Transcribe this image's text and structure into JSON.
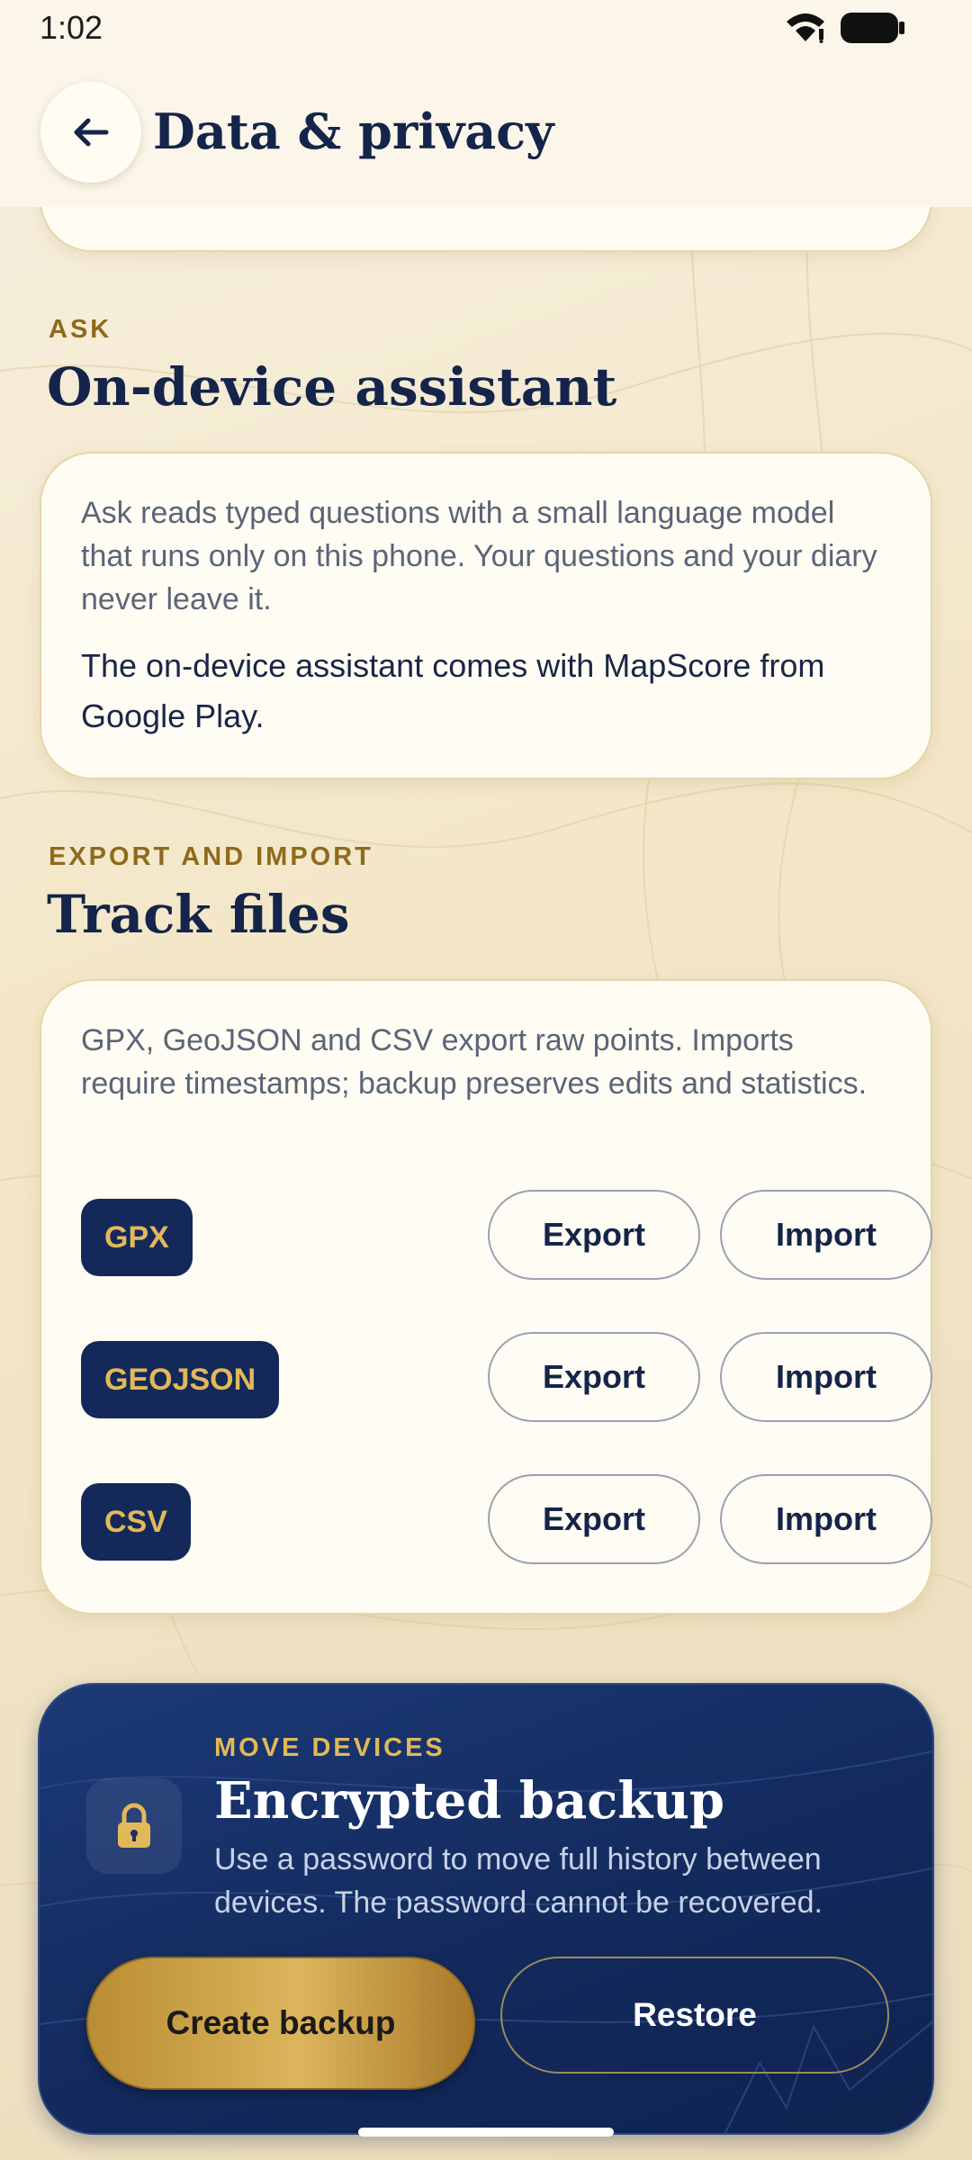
{
  "status_bar": {
    "time": "1:02"
  },
  "app_bar": {
    "title": "Data & privacy"
  },
  "ask": {
    "eyebrow": "ASK",
    "title": "On-device assistant",
    "description": "Ask reads typed questions with a small language model that runs only on this phone. Your questions and your diary never leave it.",
    "availability": "The on-device assistant comes with MapScore from Google Play."
  },
  "track_files": {
    "eyebrow": "EXPORT AND IMPORT",
    "title": "Track files",
    "description": "GPX, GeoJSON and CSV export raw points. Imports require timestamps; backup preserves edits and statistics.",
    "formats": [
      {
        "label": "GPX",
        "export_label": "Export",
        "import_label": "Import"
      },
      {
        "label": "GEOJSON",
        "export_label": "Export",
        "import_label": "Import"
      },
      {
        "label": "CSV",
        "export_label": "Export",
        "import_label": "Import"
      }
    ]
  },
  "backup": {
    "eyebrow": "MOVE DEVICES",
    "title": "Encrypted backup",
    "description": "Use a password to move full history between devices. The password cannot be recovered.",
    "create_label": "Create backup",
    "restore_label": "Restore",
    "icon": "lock-icon"
  },
  "colors": {
    "navy": "#14244a",
    "gold": "#e2b95a",
    "eyebrow_gold": "#8e6a1c",
    "cream_card": "#fffcf3",
    "backup_navy": "#132a5d"
  }
}
